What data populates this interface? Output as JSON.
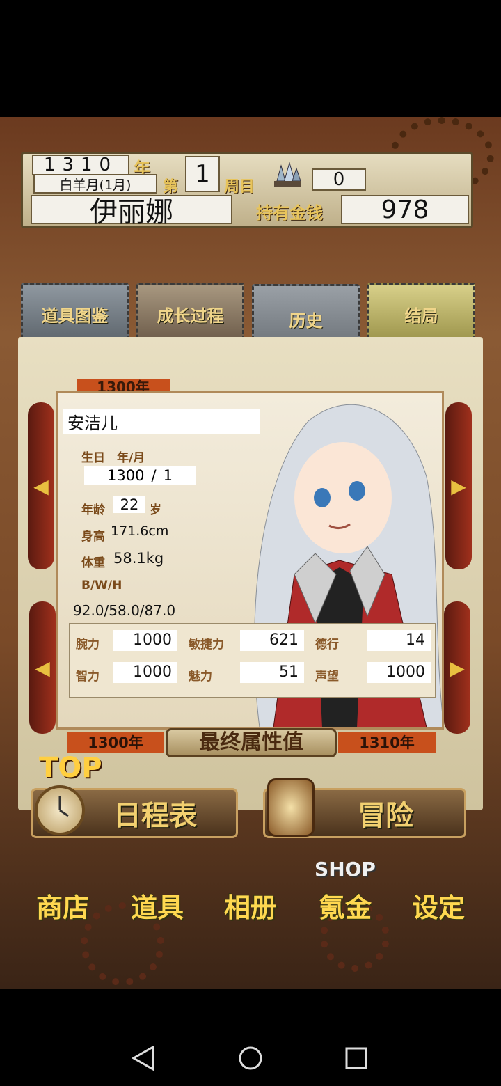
{
  "header": {
    "year_digits": "1310",
    "year_suffix": "年",
    "month": "白羊月(1月)",
    "week_prefix": "第",
    "week_num": "1",
    "week_suffix": "周目",
    "crystal_count": "0",
    "player_name": "伊丽娜",
    "gold_label": "持有金钱",
    "gold_value": "978"
  },
  "tabs": [
    {
      "label": "道具图鉴"
    },
    {
      "label": "成长过程"
    },
    {
      "label": "历史"
    },
    {
      "label": "结局"
    }
  ],
  "card": {
    "year_tag": "1300年",
    "name": "安洁儿",
    "birthday_label": "生日　年/月",
    "birth_year": "1300",
    "birth_sep": "/",
    "birth_month": "1",
    "age_label": "年龄",
    "age_value": "22",
    "age_unit": "岁",
    "height_label": "身高",
    "height_value": "171.6cm",
    "weight_label": "体重",
    "weight_value": "58.1kg",
    "bwh_label": "B/W/H",
    "bwh_value": "92.0/58.0/87.0"
  },
  "stats": [
    {
      "label": "腕力",
      "value": "1000"
    },
    {
      "label": "敏捷力",
      "value": "621"
    },
    {
      "label": "德行",
      "value": "14"
    },
    {
      "label": "智力",
      "value": "1000"
    },
    {
      "label": "魅力",
      "value": "51"
    },
    {
      "label": "声望",
      "value": "1000"
    }
  ],
  "footer": {
    "start_year": "1300年",
    "title": "最终属性值",
    "end_year": "1310年"
  },
  "menu": {
    "top_label": "TOP",
    "schedule_label": "日程表",
    "adventure_label": "冒险",
    "shop_label": "商店",
    "items_label": "道具",
    "album_label": "相册",
    "topup_label": "氪金",
    "topup_badge": "SHOP",
    "settings_label": "设定"
  },
  "icons": [
    "crystal-icon",
    "clock-icon",
    "lantern-icon",
    "left-arrow-icon",
    "right-arrow-icon",
    "back-icon",
    "home-icon",
    "recents-icon"
  ],
  "colors": {
    "accent_gold": "#e8c45a",
    "frame_brown": "#6b3a1f",
    "card_red": "#a0301c"
  }
}
